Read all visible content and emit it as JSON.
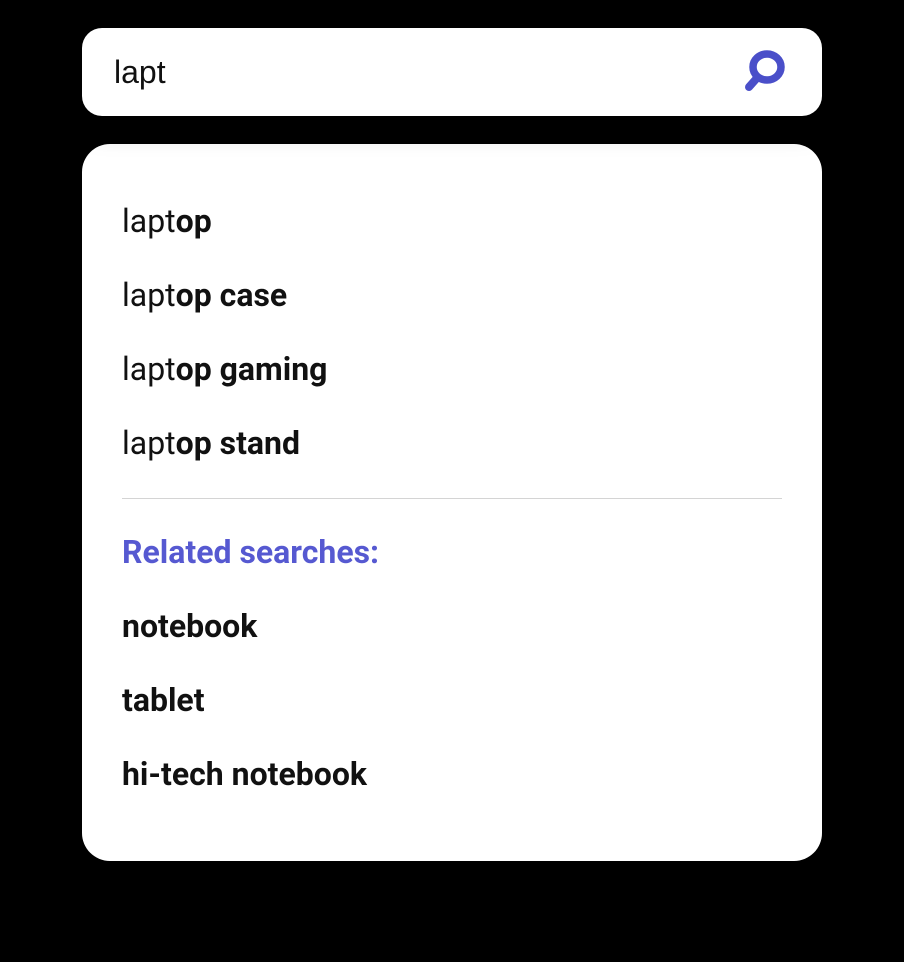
{
  "search": {
    "value": "lapt"
  },
  "suggestions": [
    {
      "prefix": "lapt",
      "completion": "op"
    },
    {
      "prefix": "lapt",
      "completion": "op case"
    },
    {
      "prefix": "lapt",
      "completion": "op gaming"
    },
    {
      "prefix": "lapt",
      "completion": "op stand"
    }
  ],
  "related": {
    "header": "Related searches:",
    "items": [
      "notebook",
      "tablet",
      "hi-tech notebook"
    ]
  },
  "colors": {
    "accent": "#4a4fc9"
  }
}
